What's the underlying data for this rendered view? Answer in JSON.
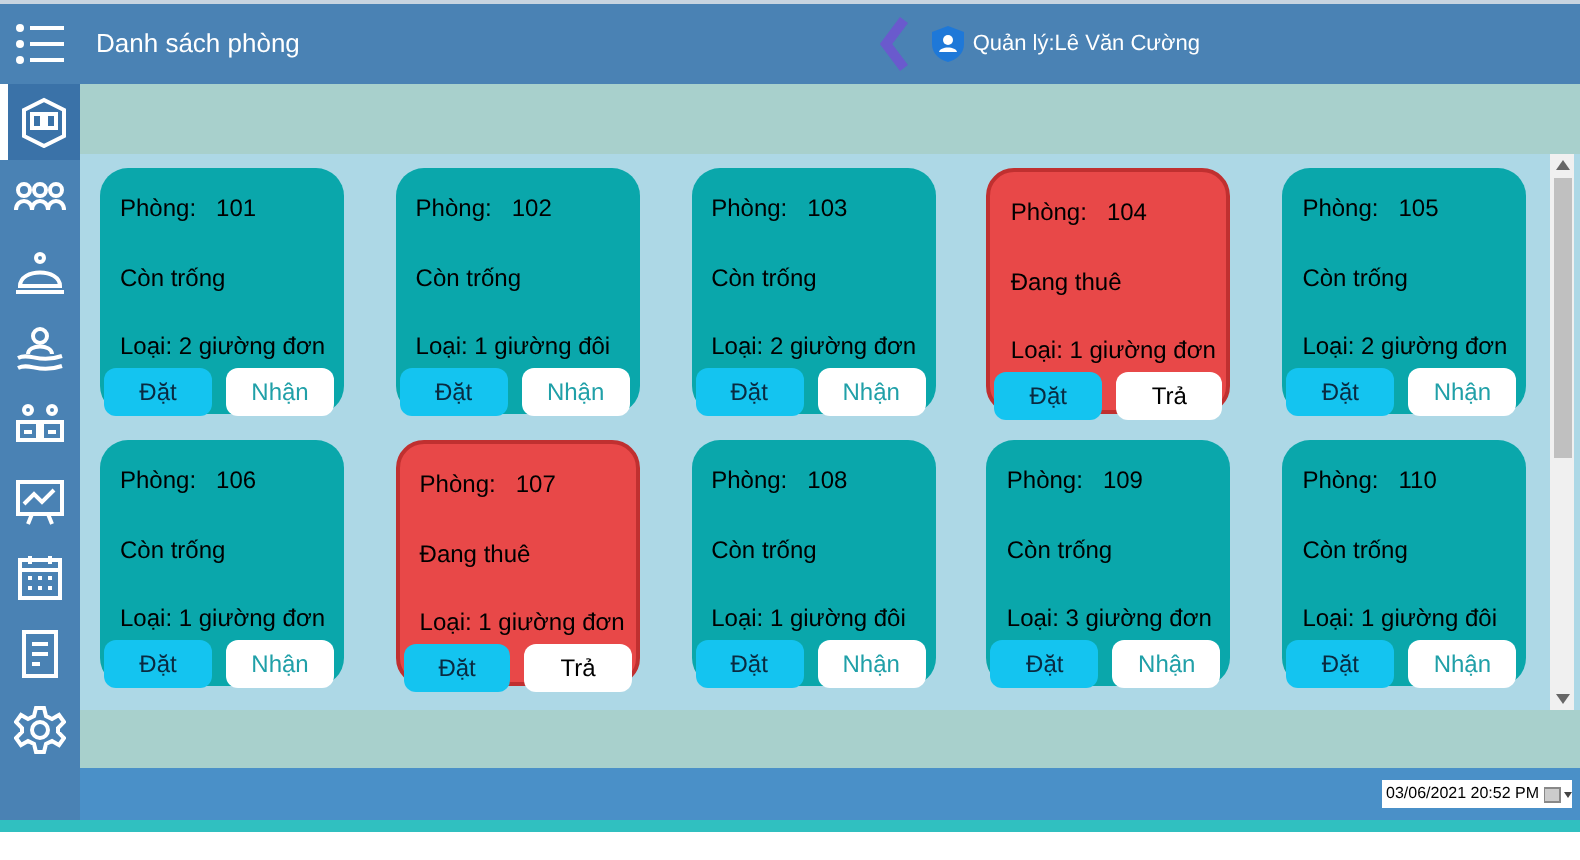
{
  "header": {
    "title": "Danh sách phòng",
    "user": "Quản lý:Lê Văn Cường"
  },
  "sidebar": {
    "items": [
      {
        "selected": true
      },
      {
        "selected": false
      },
      {
        "selected": false
      },
      {
        "selected": false
      },
      {
        "selected": false
      },
      {
        "selected": false
      },
      {
        "selected": false
      },
      {
        "selected": false
      },
      {
        "selected": false
      }
    ]
  },
  "rooms": [
    {
      "label": "Phòng:",
      "number": "101",
      "kind": "vacant",
      "status": "Còn trống",
      "type": "Loại: 2 giường đơn",
      "buttons": [
        "Đặt",
        "Nhận"
      ]
    },
    {
      "label": "Phòng:",
      "number": "102",
      "kind": "vacant",
      "status": "Còn trống",
      "type": "Loại: 1 giường đôi",
      "buttons": [
        "Đặt",
        "Nhận"
      ]
    },
    {
      "label": "Phòng:",
      "number": "103",
      "kind": "vacant",
      "status": "Còn trống",
      "type": "Loại: 2 giường đơn",
      "buttons": [
        "Đặt",
        "Nhận"
      ]
    },
    {
      "label": "Phòng:",
      "number": "104",
      "kind": "occupied",
      "status": "Đang thuê",
      "type": "Loại: 1 giường đơn",
      "buttons": [
        "Đặt",
        "Trả"
      ]
    },
    {
      "label": "Phòng:",
      "number": "105",
      "kind": "vacant",
      "status": "Còn trống",
      "type": "Loại: 2 giường đơn",
      "buttons": [
        "Đặt",
        "Nhận"
      ]
    },
    {
      "label": "Phòng:",
      "number": "106",
      "kind": "vacant",
      "status": "Còn trống",
      "type": "Loại: 1 giường đơn",
      "buttons": [
        "Đặt",
        "Nhận"
      ]
    },
    {
      "label": "Phòng:",
      "number": "107",
      "kind": "occupied",
      "status": "Đang thuê",
      "type": "Loại: 1 giường đơn",
      "buttons": [
        "Đặt",
        "Trả"
      ]
    },
    {
      "label": "Phòng:",
      "number": "108",
      "kind": "vacant",
      "status": "Còn trống",
      "type": "Loại: 1 giường đôi",
      "buttons": [
        "Đặt",
        "Nhận"
      ]
    },
    {
      "label": "Phòng:",
      "number": "109",
      "kind": "vacant",
      "status": "Còn trống",
      "type": "Loại: 3 giường đơn",
      "buttons": [
        "Đặt",
        "Nhận"
      ]
    },
    {
      "label": "Phòng:",
      "number": "110",
      "kind": "vacant",
      "status": "Còn trống",
      "type": "Loại: 1 giường đôi",
      "buttons": [
        "Đặt",
        "Nhận"
      ]
    }
  ],
  "footer": {
    "datetime": "03/06/2021 20:52 PM"
  }
}
